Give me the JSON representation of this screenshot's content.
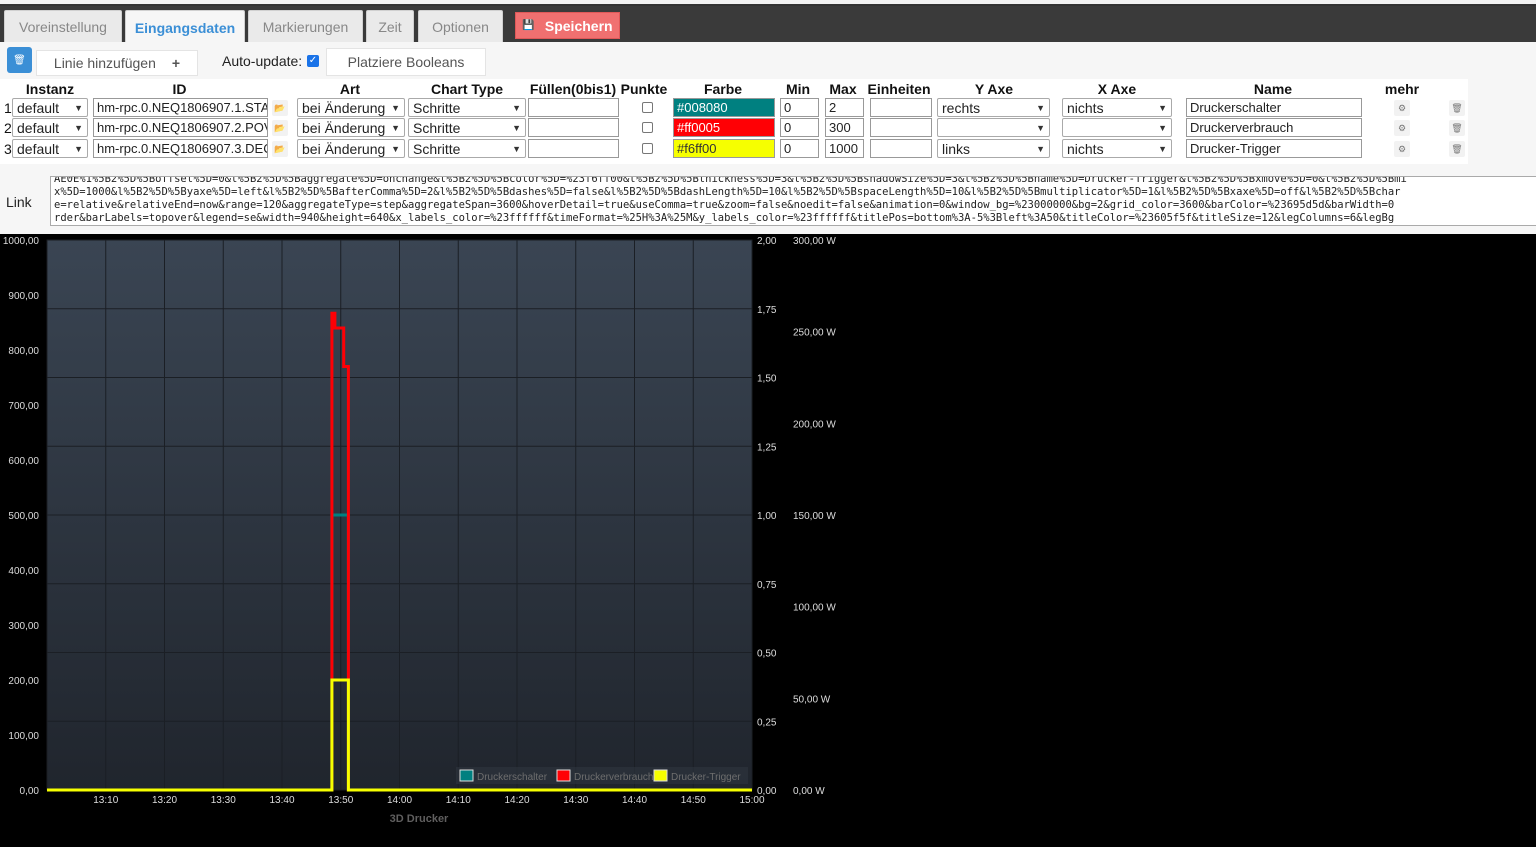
{
  "tabs": [
    {
      "label": "Voreinstellung",
      "active": false
    },
    {
      "label": "Eingangsdaten",
      "active": true
    },
    {
      "label": "Markierungen",
      "active": false
    },
    {
      "label": "Zeit",
      "active": false
    },
    {
      "label": "Optionen",
      "active": false
    }
  ],
  "save_button": {
    "label": "Speichern",
    "icon": "save-icon"
  },
  "toolbar": {
    "delete_all_icon": "trash-icon",
    "add_line_label": "Linie hinzufügen",
    "add_line_icon": "+",
    "autoupdate_label": "Auto-update:",
    "autoupdate_checked": true,
    "place_booleans_label": "Platziere Booleans"
  },
  "table": {
    "headers": {
      "instanz": "Instanz",
      "id": "ID",
      "art": "Art",
      "chart_type": "Chart Type",
      "fuellen": "Füllen(0bis1)",
      "punkte": "Punkte",
      "farbe": "Farbe",
      "min": "Min",
      "max": "Max",
      "einheiten": "Einheiten",
      "y_axe": "Y Axe",
      "x_axe": "X Axe",
      "name": "Name",
      "mehr": "mehr"
    },
    "rows": [
      {
        "num": "1",
        "instanz": "default",
        "id": "hm-rpc.0.NEQ1806907.1.STA",
        "art": "bei Änderung",
        "chart_type": "Schritte",
        "fill": "",
        "points": false,
        "color": "#008080",
        "min": "0",
        "max": "2",
        "units": "",
        "y_axe": "rechts",
        "x_axe": "nichts",
        "name": "Druckerschalter"
      },
      {
        "num": "2",
        "instanz": "default",
        "id": "hm-rpc.0.NEQ1806907.2.POV",
        "art": "bei Änderung",
        "chart_type": "Schritte",
        "fill": "",
        "points": false,
        "color": "#ff0005",
        "min": "0",
        "max": "300",
        "units": "",
        "y_axe": "",
        "x_axe": "",
        "name": "Druckerverbrauch"
      },
      {
        "num": "3",
        "instanz": "default",
        "id": "hm-rpc.0.NEQ1806907.3.DEC",
        "art": "bei Änderung",
        "chart_type": "Schritte",
        "fill": "",
        "points": false,
        "color": "#f6ff00",
        "min": "0",
        "max": "1000",
        "units": "",
        "y_axe": "links",
        "x_axe": "nichts",
        "name": "Drucker-Trigger"
      }
    ]
  },
  "link": {
    "label": "Link",
    "lines": [
      "AE0E%1%5B2%5D%5Boffset%5D=0&l%5B2%5D%5Baggregate%5D=onchange&l%5B2%5D%5Bcolor%5D=%23f6ff00&l%5B2%5D%5Bthickness%5D=3&l%5B2%5D%5BshadowSize%5D=3&l%5B2%5D%5Bname%5D=Drucker-Trigger&l%5B2%5D%5Bxmove%5D=0&l%5B2%5D%5Bmi",
      "x%5D=1000&l%5B2%5D%5Byaxe%5D=left&l%5B2%5D%5BafterComma%5D=2&l%5B2%5D%5Bdashes%5D=false&l%5B2%5D%5BdashLength%5D=10&l%5B2%5D%5BspaceLength%5D=10&l%5B2%5D%5Bmultiplicator%5D=1&l%5B2%5D%5Bxaxe%5D=off&l%5B2%5D%5Bchar",
      "e=relative&relativeEnd=now&range=120&aggregateType=step&aggregateSpan=3600&hoverDetail=true&useComma=true&zoom=false&noedit=false&animation=0&window_bg=%23000000&bg=2&grid_color=3600&barColor=%23695d5d&barWidth=0",
      "rder&barLabels=topover&legend=se&width=940&height=640&x_labels_color=%23ffffff&timeFormat=%25H%3A%25M&y_labels_color=%23ffffff&titlePos=bottom%3A-5%3Bleft%3A50&titleColor=%23605f5f&titleSize=12&legColumns=6&legBg"
    ]
  },
  "chart_data": {
    "type": "line",
    "title": "3D Drucker",
    "x_ticks": [
      "13:10",
      "13:20",
      "13:30",
      "13:40",
      "13:50",
      "14:00",
      "14:10",
      "14:20",
      "14:30",
      "14:40",
      "14:50",
      "15:00"
    ],
    "x_range": [
      "13:00",
      "15:00"
    ],
    "y_left": {
      "ticks": [
        "1000,00",
        "900,00",
        "800,00",
        "700,00",
        "600,00",
        "500,00",
        "400,00",
        "300,00",
        "200,00",
        "100,00",
        "0,00"
      ],
      "range": [
        0,
        1000
      ]
    },
    "y_right": {
      "ticks": [
        "2,00",
        "1,75",
        "1,50",
        "1,25",
        "1,00",
        "0,75",
        "0,50",
        "0,25",
        "0,00"
      ],
      "range": [
        0,
        2
      ]
    },
    "y_right2": {
      "ticks": [
        "300,00 W",
        "250,00 W",
        "200,00 W",
        "150,00 W",
        "100,00 W",
        "50,00 W",
        "0,00 W"
      ],
      "range": [
        0,
        300
      ]
    },
    "series": [
      {
        "name": "Druckerschalter",
        "color": "#008080",
        "axis": "right",
        "step": true,
        "points": [
          [
            "13:00",
            0
          ],
          [
            "13:48.5",
            0
          ],
          [
            "13:48.5",
            1
          ],
          [
            "13:51.3",
            1
          ],
          [
            "13:51.3",
            0
          ],
          [
            "15:00",
            0
          ]
        ]
      },
      {
        "name": "Druckerverbrauch",
        "color": "#ff0005",
        "axis": "right2",
        "step": true,
        "points": [
          [
            "13:00",
            0
          ],
          [
            "13:48.5",
            0
          ],
          [
            "13:48.5",
            260
          ],
          [
            "13:49",
            260
          ],
          [
            "13:49",
            252
          ],
          [
            "13:50.5",
            252
          ],
          [
            "13:50.5",
            231
          ],
          [
            "13:51.3",
            231
          ],
          [
            "13:51.3",
            0
          ],
          [
            "15:00",
            0
          ]
        ]
      },
      {
        "name": "Drucker-Trigger",
        "color": "#f6ff00",
        "axis": "left",
        "step": true,
        "points": [
          [
            "13:00",
            0
          ],
          [
            "13:48.5",
            0
          ],
          [
            "13:48.5",
            200
          ],
          [
            "13:51.3",
            200
          ],
          [
            "13:51.3",
            0
          ],
          [
            "15:00",
            0
          ]
        ]
      }
    ],
    "legend": "bottom-right",
    "grid": true
  }
}
